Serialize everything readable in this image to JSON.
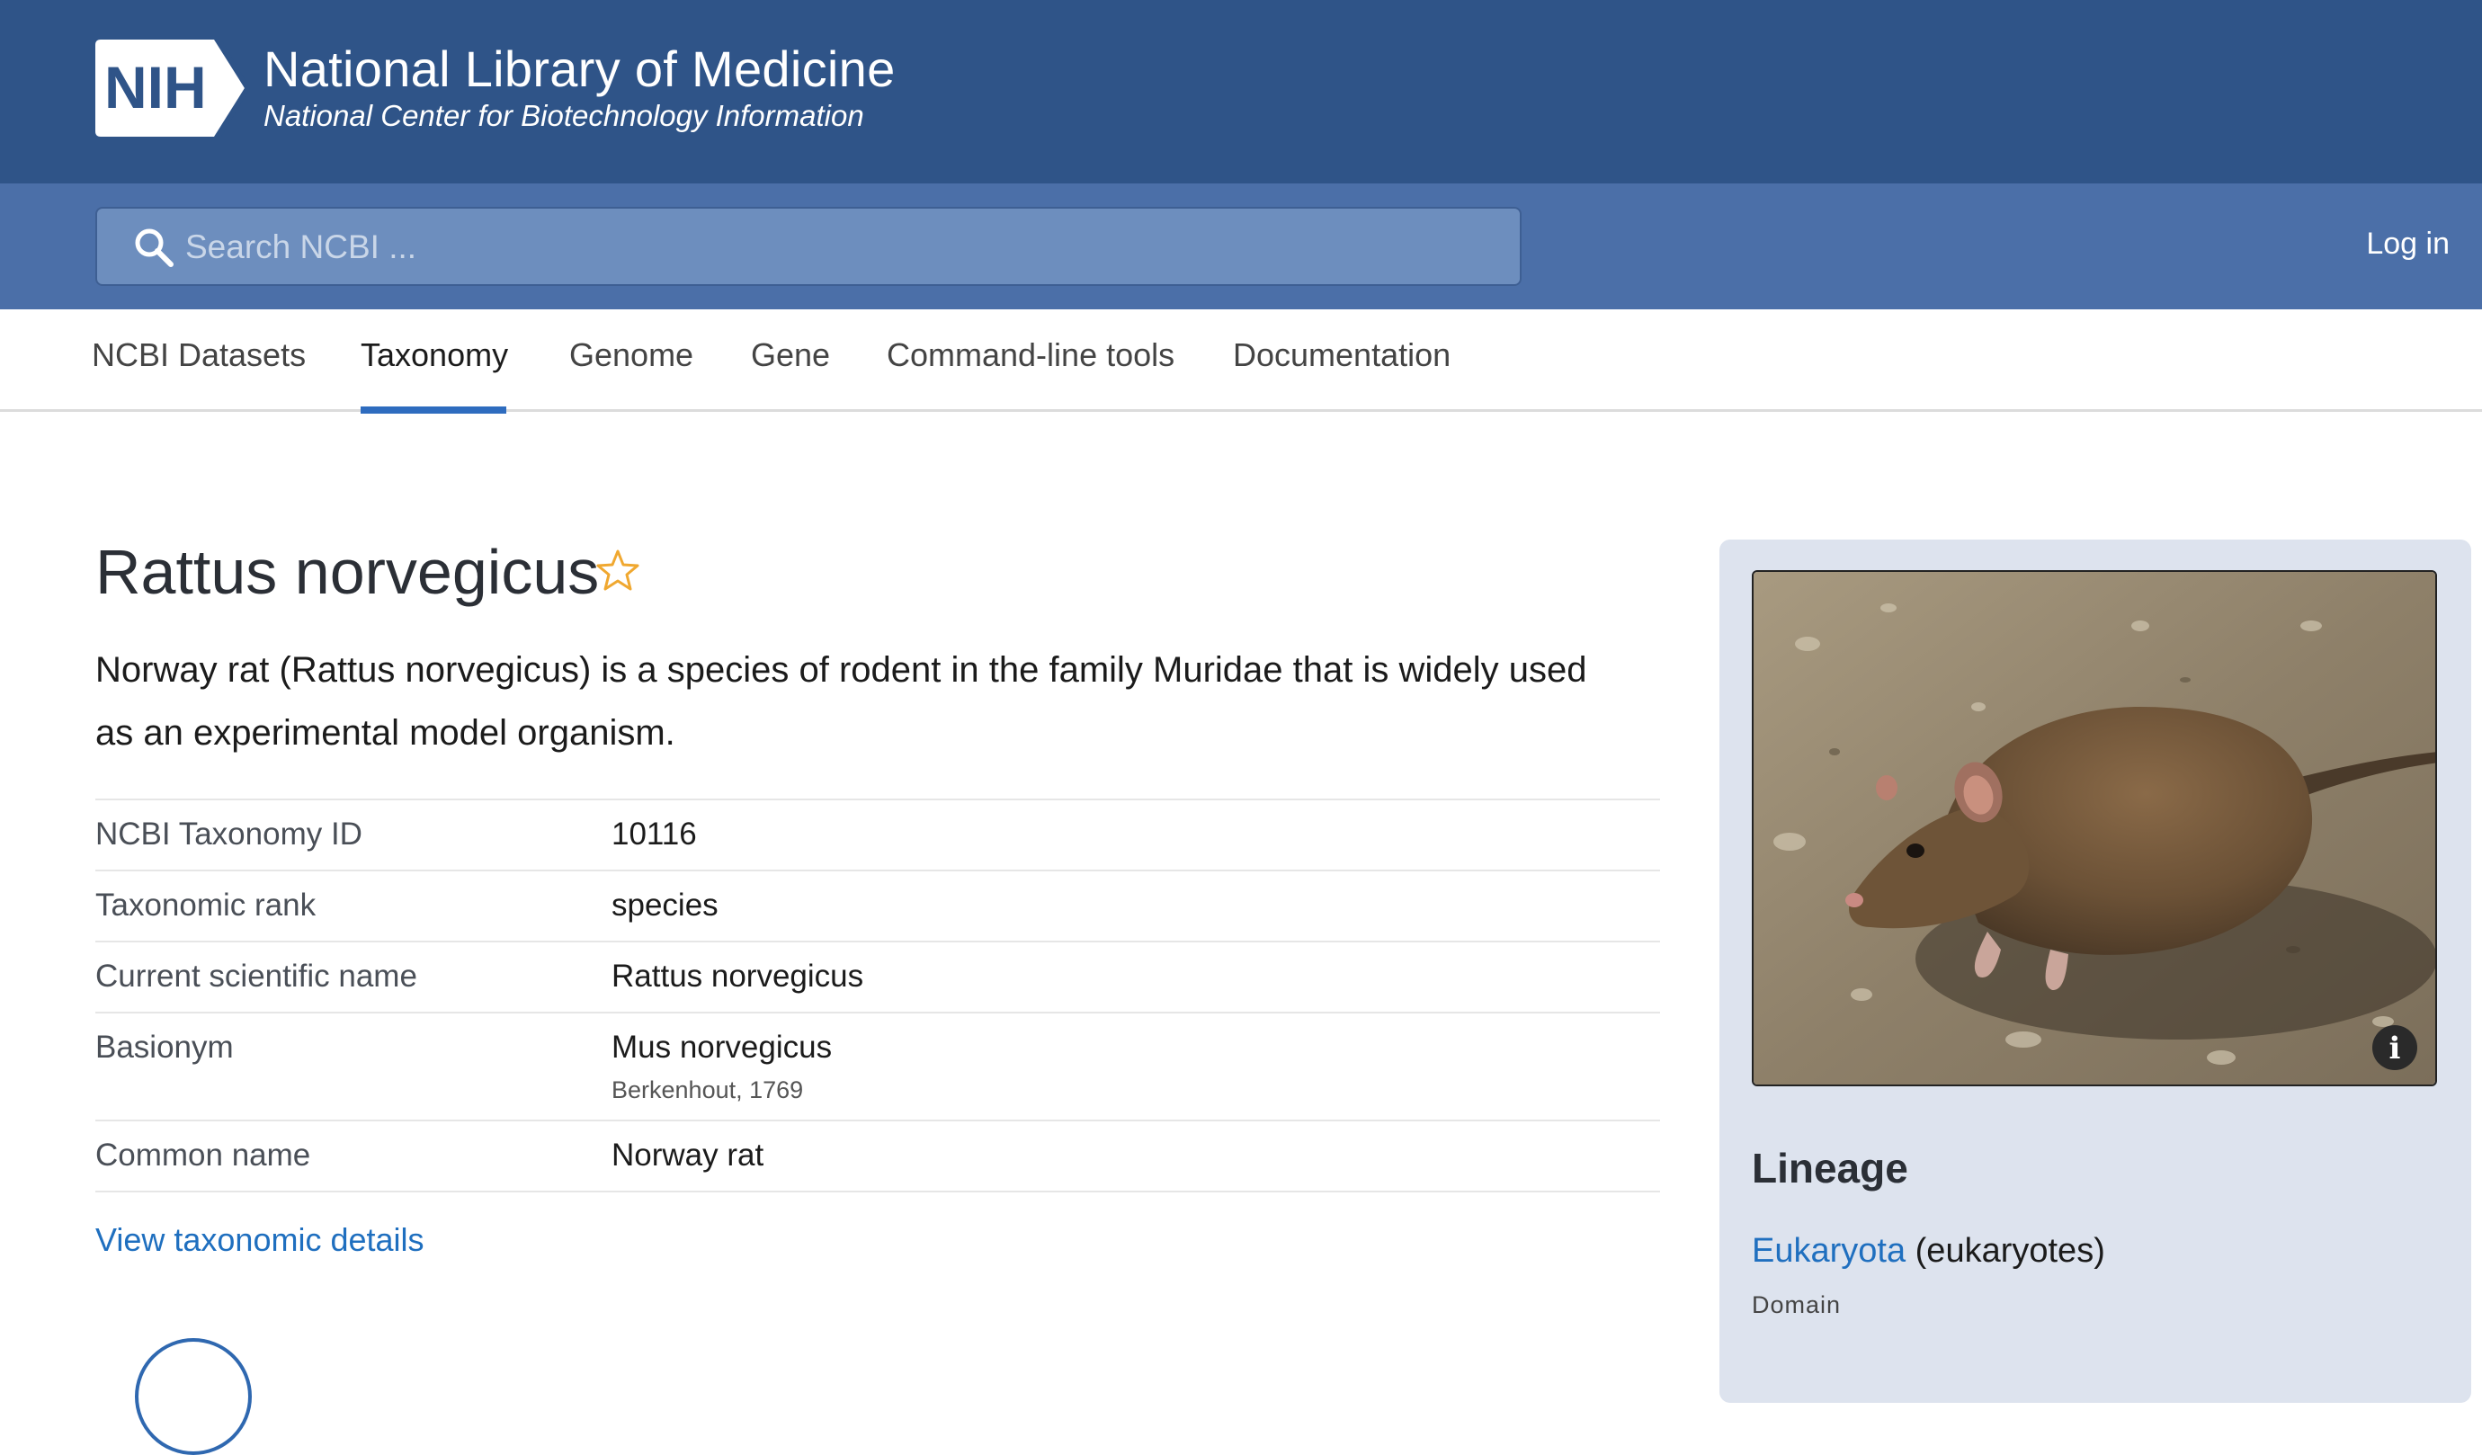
{
  "header": {
    "logo_text": "NIH",
    "title": "National Library of Medicine",
    "subtitle": "National Center for Biotechnology Information"
  },
  "search": {
    "placeholder": "Search NCBI ...",
    "value": ""
  },
  "account": {
    "login_label": "Log in"
  },
  "tabs": [
    {
      "label": "NCBI Datasets",
      "active": false
    },
    {
      "label": "Taxonomy",
      "active": true
    },
    {
      "label": "Genome",
      "active": false
    },
    {
      "label": "Gene",
      "active": false
    },
    {
      "label": "Command-line tools",
      "active": false
    },
    {
      "label": "Documentation",
      "active": false
    }
  ],
  "organism": {
    "name": "Rattus norvegicus",
    "description": "Norway rat (Rattus norvegicus) is a species of rodent in the family Muridae that is widely used as an experimental model organism.",
    "facts": [
      {
        "label": "NCBI Taxonomy ID",
        "value": "10116",
        "sub": ""
      },
      {
        "label": "Taxonomic rank",
        "value": "species",
        "sub": ""
      },
      {
        "label": "Current scientific name",
        "value": "Rattus norvegicus",
        "sub": ""
      },
      {
        "label": "Basionym",
        "value": "Mus norvegicus",
        "sub": "Berkenhout, 1769"
      },
      {
        "label": "Common name",
        "value": "Norway rat",
        "sub": ""
      }
    ],
    "details_link": "View taxonomic details"
  },
  "side_panel": {
    "image_icon": "info-icon",
    "lineage_title": "Lineage",
    "lineage": [
      {
        "name": "Eukaryota",
        "common": "(eukaryotes)",
        "rank": "Domain"
      }
    ]
  },
  "colors": {
    "header_bg": "#2f5488",
    "search_band_bg": "#4b6fa8",
    "accent_link": "#1f6fbf",
    "tab_active_underline": "#2e6cbf",
    "star": "#f0a830",
    "side_panel_bg": "#dde3ee"
  }
}
